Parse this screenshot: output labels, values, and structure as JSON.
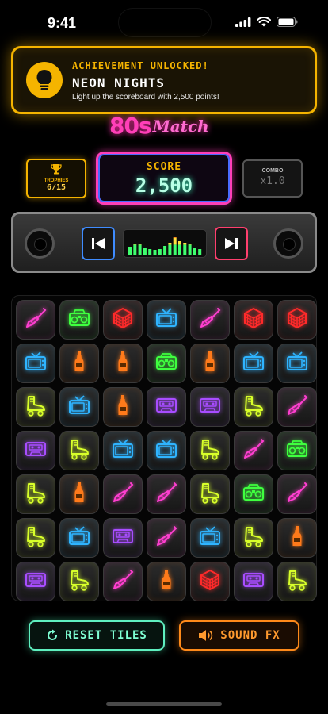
{
  "status_bar": {
    "time": "9:41"
  },
  "achievement": {
    "kicker": "ACHIEVEMENT UNLOCKED!",
    "title": "NEON NIGHTS",
    "description": "Light up the scoreboard with 2,500 points!",
    "icon": "lightbulb-icon"
  },
  "logo": {
    "part1": "80s",
    "part2": "Match"
  },
  "trophies": {
    "label": "TROPHIES",
    "value": "6/15"
  },
  "score": {
    "label": "SCORE",
    "value": "2,500"
  },
  "combo": {
    "label": "COMBO",
    "value": "x1.0"
  },
  "boombox": {
    "prev_icon": "skip-back-icon",
    "next_icon": "skip-forward-icon",
    "eq_levels": [
      0.35,
      0.5,
      0.45,
      0.3,
      0.25,
      0.2,
      0.25,
      0.4,
      0.55,
      0.8,
      0.6,
      0.55,
      0.45,
      0.3,
      0.25
    ]
  },
  "colors": {
    "guitar": "#ff3fd0",
    "boombox": "#3fff3f",
    "cube": "#ff2a2a",
    "tv": "#2fb4ff",
    "bottle": "#ff7a1a",
    "skate": "#d8ff2a",
    "cassette": "#a84dff"
  },
  "board": {
    "rows": [
      [
        "guitar",
        "boombox",
        "cube",
        "tv",
        "guitar",
        "cube",
        "cube"
      ],
      [
        "tv",
        "bottle",
        "bottle",
        "boombox",
        "bottle",
        "tv",
        "tv"
      ],
      [
        "skate",
        "tv",
        "bottle",
        "cassette",
        "cassette",
        "skate",
        "guitar"
      ],
      [
        "cassette",
        "skate",
        "tv",
        "tv",
        "skate",
        "guitar",
        "boombox"
      ],
      [
        "skate",
        "bottle",
        "guitar",
        "guitar",
        "skate",
        "boombox",
        "guitar"
      ],
      [
        "skate",
        "tv",
        "cassette",
        "guitar",
        "tv",
        "skate",
        "bottle"
      ],
      [
        "cassette",
        "skate",
        "guitar",
        "bottle",
        "cube",
        "cassette",
        "skate"
      ]
    ]
  },
  "buttons": {
    "reset": {
      "label": "RESET TILES",
      "icon": "refresh-icon"
    },
    "sound": {
      "label": "SOUND FX",
      "icon": "speaker-icon"
    }
  }
}
